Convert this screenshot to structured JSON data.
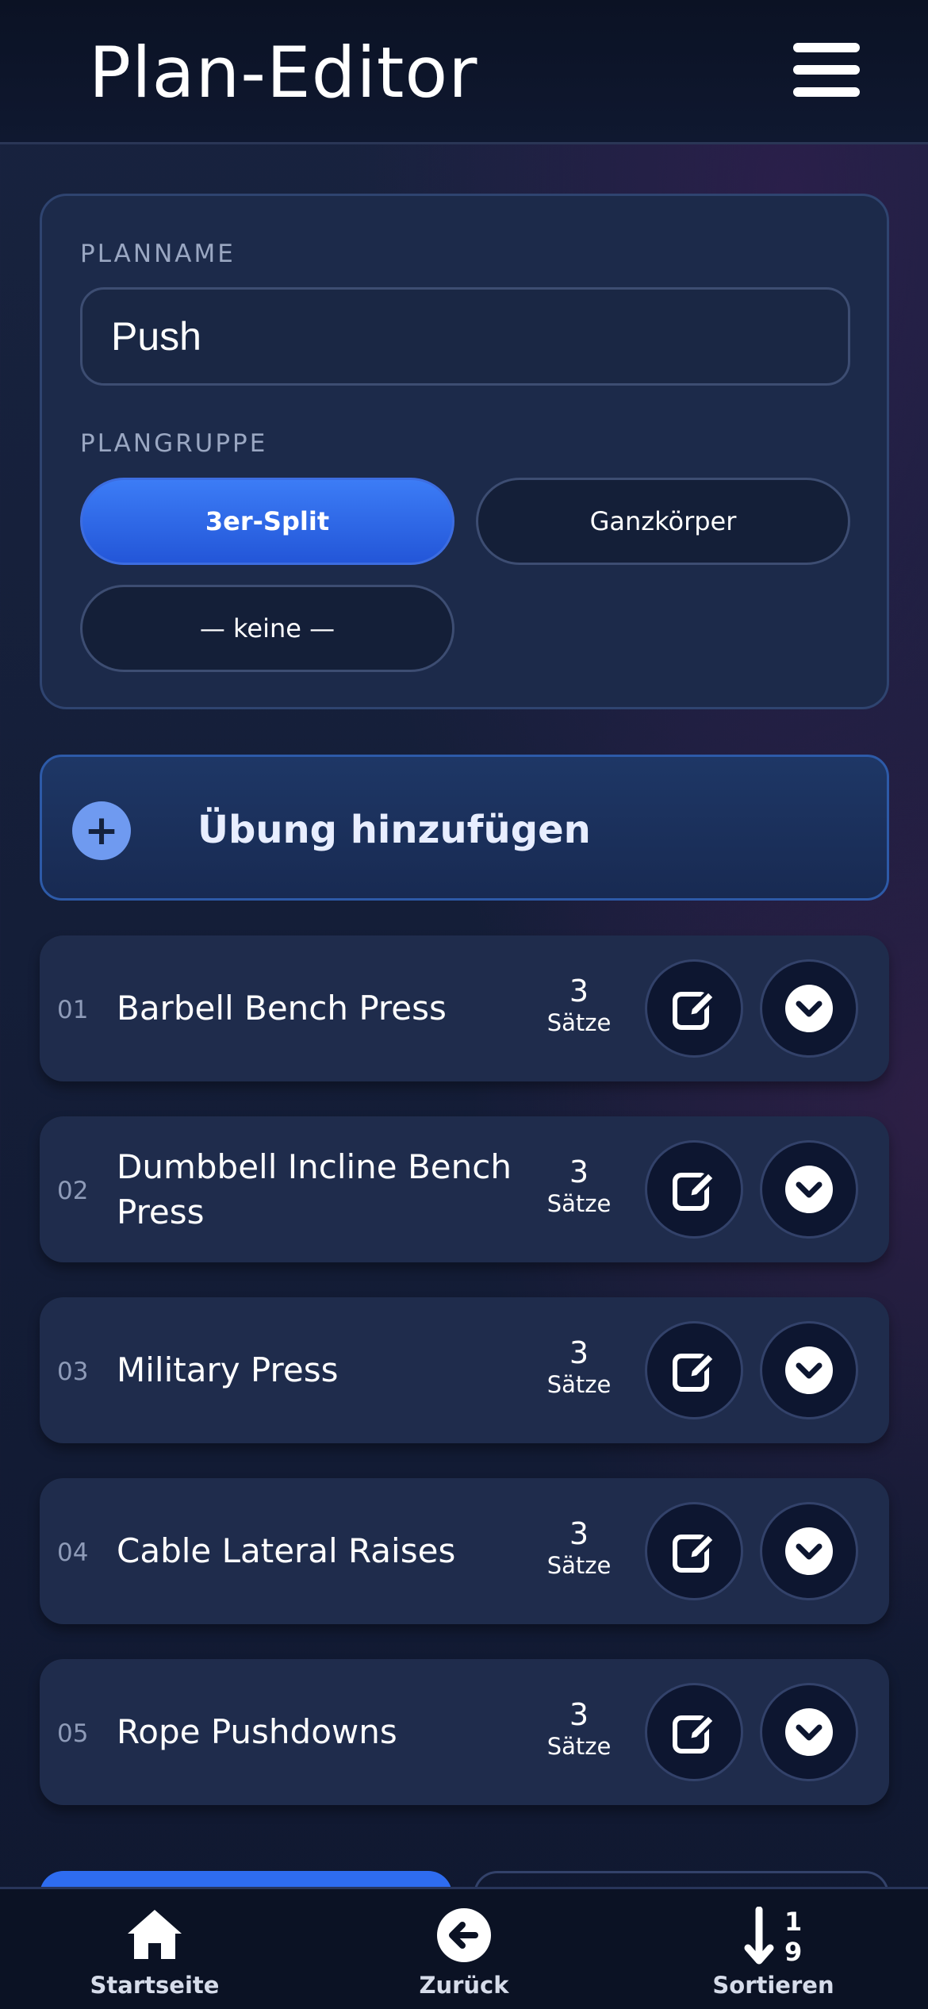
{
  "header": {
    "title": "Plan-Editor",
    "menu_icon": "hamburger-menu-icon"
  },
  "plan": {
    "name_label": "PLANNAME",
    "name_value": "Push",
    "group_label": "PLANGRUPPE",
    "groups": [
      {
        "label": "3er-Split",
        "selected": true
      },
      {
        "label": "Ganzkörper",
        "selected": false
      },
      {
        "label": "— keine —",
        "selected": false
      }
    ]
  },
  "add_exercise": {
    "label": "Übung hinzufügen",
    "icon": "plus-icon"
  },
  "exercises": [
    {
      "num": "01",
      "name": "Barbell Bench Press",
      "sets": "3",
      "sets_unit": "Sätze"
    },
    {
      "num": "02",
      "name": "Dumbbell Incline Bench Press",
      "sets": "3",
      "sets_unit": "Sätze"
    },
    {
      "num": "03",
      "name": "Military Press",
      "sets": "3",
      "sets_unit": "Sätze"
    },
    {
      "num": "04",
      "name": "Cable Lateral Raises",
      "sets": "3",
      "sets_unit": "Sätze"
    },
    {
      "num": "05",
      "name": "Rope Pushdowns",
      "sets": "3",
      "sets_unit": "Sätze"
    }
  ],
  "tabbar": {
    "home": "Startseite",
    "back": "Zurück",
    "sort": "Sortieren"
  },
  "colors": {
    "accent": "#2f6cf0",
    "card": "#1f2c4c",
    "background": "#141d36"
  }
}
